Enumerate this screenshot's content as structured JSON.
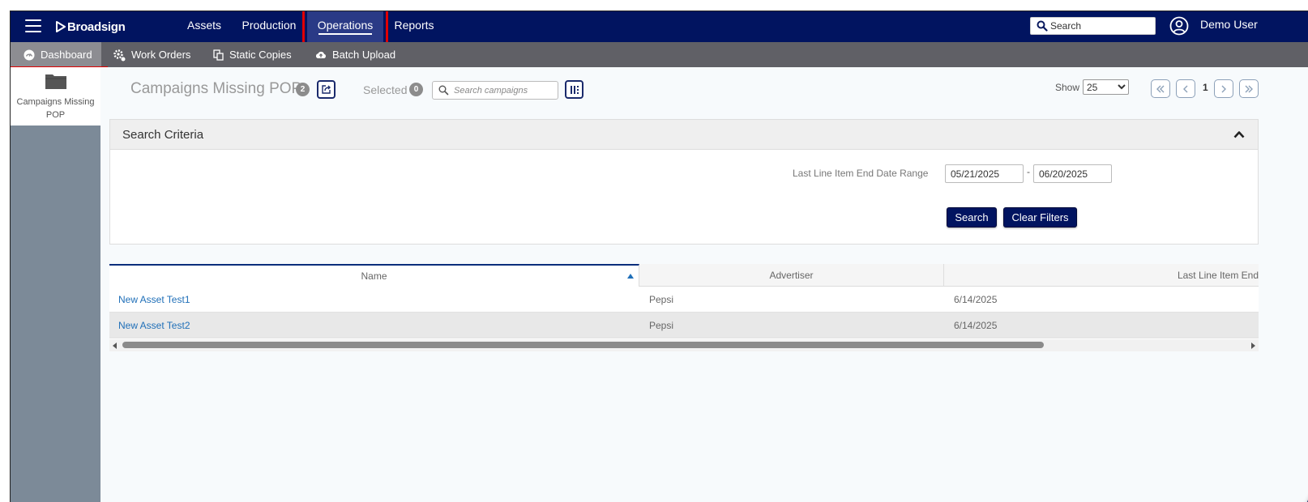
{
  "topnav": {
    "brand": "Broadsign",
    "items": [
      {
        "label": "Assets"
      },
      {
        "label": "Production"
      },
      {
        "label": "Operations"
      },
      {
        "label": "Reports"
      }
    ],
    "active": "Operations",
    "search_placeholder": "Search",
    "user_name": "Demo User"
  },
  "subnav": {
    "items": [
      {
        "label": "Dashboard",
        "icon": "dashboard-gauge-icon"
      },
      {
        "label": "Work Orders",
        "icon": "gears-icon"
      },
      {
        "label": "Static Copies",
        "icon": "copy-icon"
      },
      {
        "label": "Batch Upload",
        "icon": "cloud-upload-icon"
      }
    ],
    "active": "Dashboard"
  },
  "sidebar": {
    "items": [
      {
        "label": "Campaigns Missing POP",
        "icon": "folder-icon"
      }
    ]
  },
  "page": {
    "title": "Campaigns Missing POP",
    "title_count": "2",
    "selected_label": "Selected",
    "selected_count": "0",
    "campaign_search_placeholder": "Search campaigns"
  },
  "pagination": {
    "show_label": "Show",
    "page_size": "25",
    "page_size_options": [
      "25"
    ],
    "current_page": "1"
  },
  "search_criteria": {
    "title": "Search Criteria",
    "date_range_label": "Last Line Item End Date Range",
    "date_start": "05/21/2025",
    "date_separator": "-",
    "date_end": "06/20/2025",
    "search_button": "Search",
    "clear_button": "Clear Filters"
  },
  "table": {
    "columns": [
      "Name",
      "Advertiser",
      "Last Line Item End D"
    ],
    "sort_column": "Name",
    "sort_direction": "ascending",
    "rows": [
      {
        "name": "New Asset Test1",
        "advertiser": "Pepsi",
        "end_date": "6/14/2025"
      },
      {
        "name": "New Asset Test2",
        "advertiser": "Pepsi",
        "end_date": "6/14/2025"
      }
    ]
  },
  "colors": {
    "nav_bg": "#011460",
    "subnav_bg": "#606066",
    "highlight_box": "#e00000",
    "link": "#1f6fb8",
    "sidebar_bg": "#7c8a98"
  }
}
